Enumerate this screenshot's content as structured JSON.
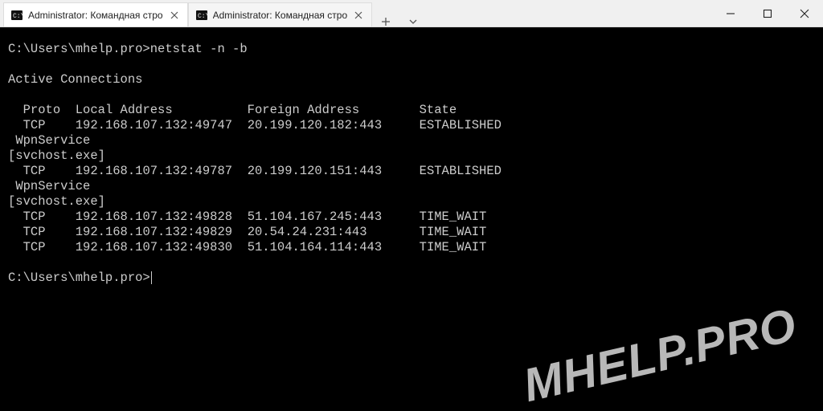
{
  "tabs": [
    {
      "title": "Administrator: Командная стро",
      "active": true
    },
    {
      "title": "Administrator: Командная стро",
      "active": false
    }
  ],
  "terminal": {
    "prompt1_path": "C:\\Users\\mhelp.pro>",
    "command": "netstat -n -b",
    "header_blank": "",
    "active_connections": "Active Connections",
    "columns": {
      "proto": "Proto",
      "local": "Local Address",
      "foreign": "Foreign Address",
      "state": "State"
    },
    "rows": [
      {
        "proto": "TCP",
        "local": "192.168.107.132:49747",
        "foreign": "20.199.120.182:443",
        "state": "ESTABLISHED",
        "service": "WpnService",
        "exe": "[svchost.exe]"
      },
      {
        "proto": "TCP",
        "local": "192.168.107.132:49787",
        "foreign": "20.199.120.151:443",
        "state": "ESTABLISHED",
        "service": "WpnService",
        "exe": "[svchost.exe]"
      },
      {
        "proto": "TCP",
        "local": "192.168.107.132:49828",
        "foreign": "51.104.167.245:443",
        "state": "TIME_WAIT"
      },
      {
        "proto": "TCP",
        "local": "192.168.107.132:49829",
        "foreign": "20.54.24.231:443",
        "state": "TIME_WAIT"
      },
      {
        "proto": "TCP",
        "local": "192.168.107.132:49830",
        "foreign": "51.104.164.114:443",
        "state": "TIME_WAIT"
      }
    ],
    "prompt2_path": "C:\\Users\\mhelp.pro>"
  },
  "watermark": "MHELP.PRO"
}
